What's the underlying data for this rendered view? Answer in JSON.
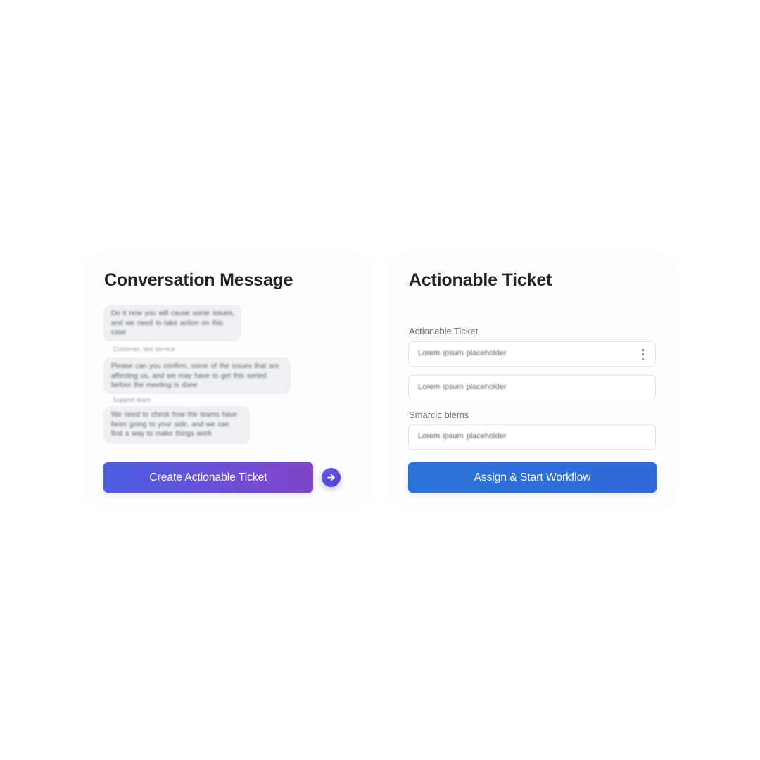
{
  "conversation": {
    "title": "Conversation Message",
    "messages": [
      {
        "text": "Do it now you will cause some issues, and we need to take action on this case"
      },
      {
        "text": "Please can you confirm, some of the issues that are affecting us, and we may have to get this sorted before the meeting is done"
      },
      {
        "text": "We need to check how the teams have been going to your side, and we can find a way to make things work"
      }
    ],
    "captions": [
      "Customer, last service",
      "Support team"
    ],
    "create_button_label": "Create Actionable Ticket",
    "arrow_icon": "arrow-right-icon",
    "button_gradient": [
      "#4b5ee0",
      "#8044c8"
    ]
  },
  "ticket": {
    "title": "Actionable Ticket",
    "field_label_1": "Actionable Ticket",
    "field_1_value": "Lorem ipsum placeholder",
    "field_2_value": "Lorem ipsum placeholder",
    "field_label_2": "Smarcic blems",
    "field_3_value": "Lorem ipsum placeholder",
    "menu_icon": "more-vertical-icon",
    "assign_button_label": "Assign & Start Workflow",
    "button_color": "#2b72d8"
  }
}
